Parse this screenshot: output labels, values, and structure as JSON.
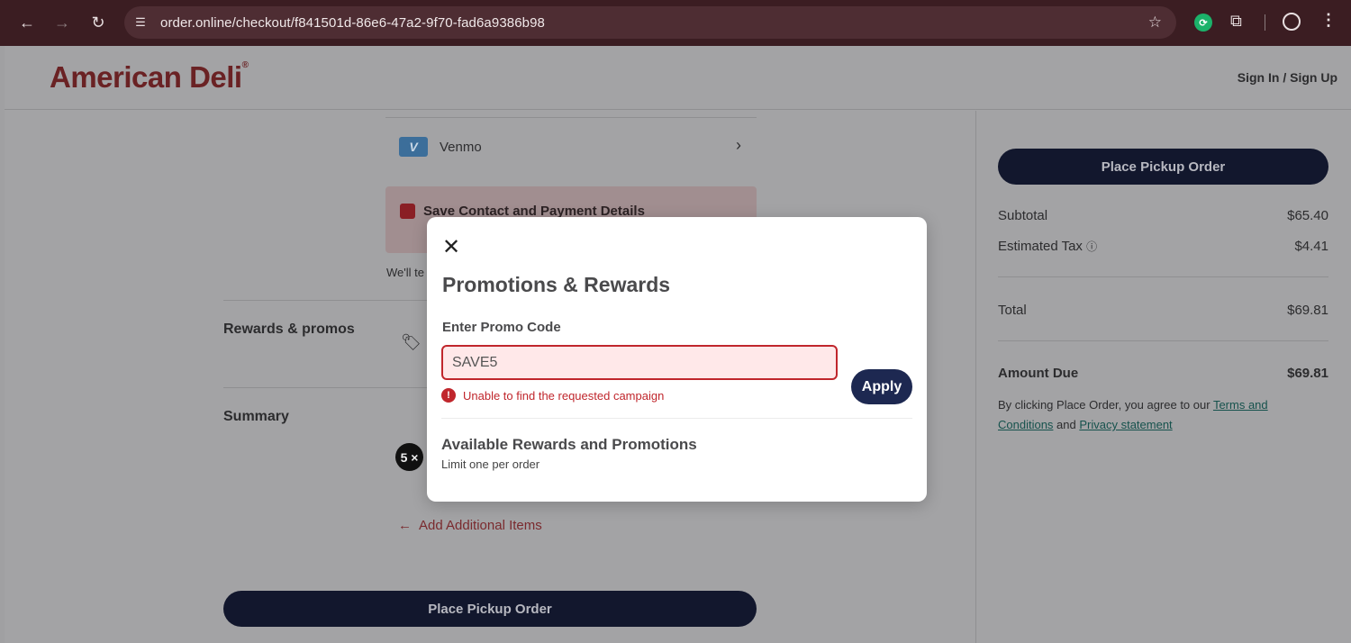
{
  "browser": {
    "url": "order.online/checkout/f841501d-86e6-47a2-9f70-fad6a9386b98"
  },
  "header": {
    "logo_text": "American Deli",
    "logo_mark": "®",
    "signin": "Sign In / Sign Up"
  },
  "payment": {
    "venmo_badge": "V",
    "venmo_label": "Venmo",
    "save_details": "Save Contact and Payment Details",
    "well_text": "We'll te"
  },
  "sections": {
    "rewards_label": "Rewards & promos",
    "summary_label": "Summary",
    "qty_badge": "5 ×",
    "add_items": "Add Additional Items",
    "place_order": "Place Pickup Order"
  },
  "order_summary": {
    "place_order": "Place Pickup Order",
    "subtotal_label": "Subtotal",
    "subtotal_value": "$65.40",
    "tax_label": "Estimated Tax",
    "tax_value": "$4.41",
    "total_label": "Total",
    "total_value": "$69.81",
    "due_label": "Amount Due",
    "due_value": "$69.81",
    "agree_prefix": "By clicking Place Order, you agree to our ",
    "terms_link": "Terms and Conditions",
    "agree_and": " and ",
    "privacy_link": "Privacy statement"
  },
  "modal": {
    "title": "Promotions & Rewards",
    "promo_label": "Enter Promo Code",
    "promo_value": "SAVE5",
    "error_text": "Unable to find the requested campaign",
    "apply": "Apply",
    "available_title": "Available Rewards and Promotions",
    "available_sub": "Limit one per order"
  },
  "icons": {
    "back": "arrow-left-icon",
    "forward": "arrow-right-icon",
    "reload": "reload-icon",
    "site_info": "tune-icon",
    "bookmark": "star-icon",
    "extension": "puzzle-icon",
    "profile": "profile-icon",
    "menu": "kebab-icon",
    "close": "close-icon",
    "error": "error-icon",
    "tag": "tag-icon"
  },
  "colors": {
    "brand_red": "#8a1f25",
    "navy": "#1d2851",
    "error": "#c0262c",
    "link_green": "#16524d"
  }
}
